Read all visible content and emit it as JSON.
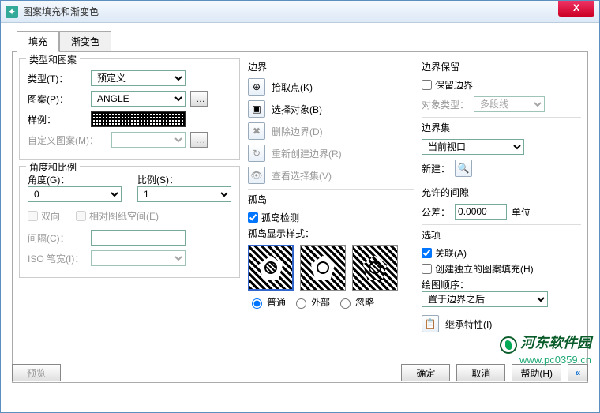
{
  "window": {
    "title": "图案填充和渐变色"
  },
  "tabs": {
    "fill": "填充",
    "gradient": "渐变色"
  },
  "typePattern": {
    "title": "类型和图案",
    "type_label": "类型(T)：",
    "type_value": "预定义",
    "pattern_label": "图案(P)：",
    "pattern_value": "ANGLE",
    "sample_label": "样例：",
    "custom_label": "自定义图案(M)："
  },
  "angleScale": {
    "title": "角度和比例",
    "angle_label": "角度(G)：",
    "angle_value": "0",
    "scale_label": "比例(S)：",
    "scale_value": "1",
    "bidir": "双向",
    "relpaper": "相对图纸空间(E)",
    "gap_label": "间隔(C)：",
    "iso_label": "ISO 笔宽(I)："
  },
  "boundary": {
    "title": "边界",
    "pick": "拾取点(K)",
    "selobj": "选择对象(B)",
    "delbound": "删除边界(D)",
    "recreate": "重新创建边界(R)",
    "viewsel": "查看选择集(V)"
  },
  "island": {
    "title": "孤岛",
    "detect": "孤岛检测",
    "style_label": "孤岛显示样式：",
    "normal": "普通",
    "outer": "外部",
    "ignore": "忽略"
  },
  "retain": {
    "title": "边界保留",
    "keep": "保留边界",
    "objtype_label": "对象类型：",
    "objtype_value": "多段线"
  },
  "boundset": {
    "title": "边界集",
    "value": "当前视口",
    "new_label": "新建："
  },
  "gap": {
    "title": "允许的间隙",
    "tol_label": "公差：",
    "tol_value": "0.0000",
    "unit": "单位"
  },
  "options": {
    "title": "选项",
    "assoc": "关联(A)",
    "indep": "创建独立的图案填充(H)",
    "order_label": "绘图顺序：",
    "order_value": "置于边界之后",
    "inherit": "继承特性(I)"
  },
  "footer": {
    "preview": "预览",
    "ok": "确定",
    "cancel": "取消",
    "help": "帮助(H)"
  },
  "watermark": {
    "name": "河东软件园",
    "url": "www.pc0359.cn"
  }
}
